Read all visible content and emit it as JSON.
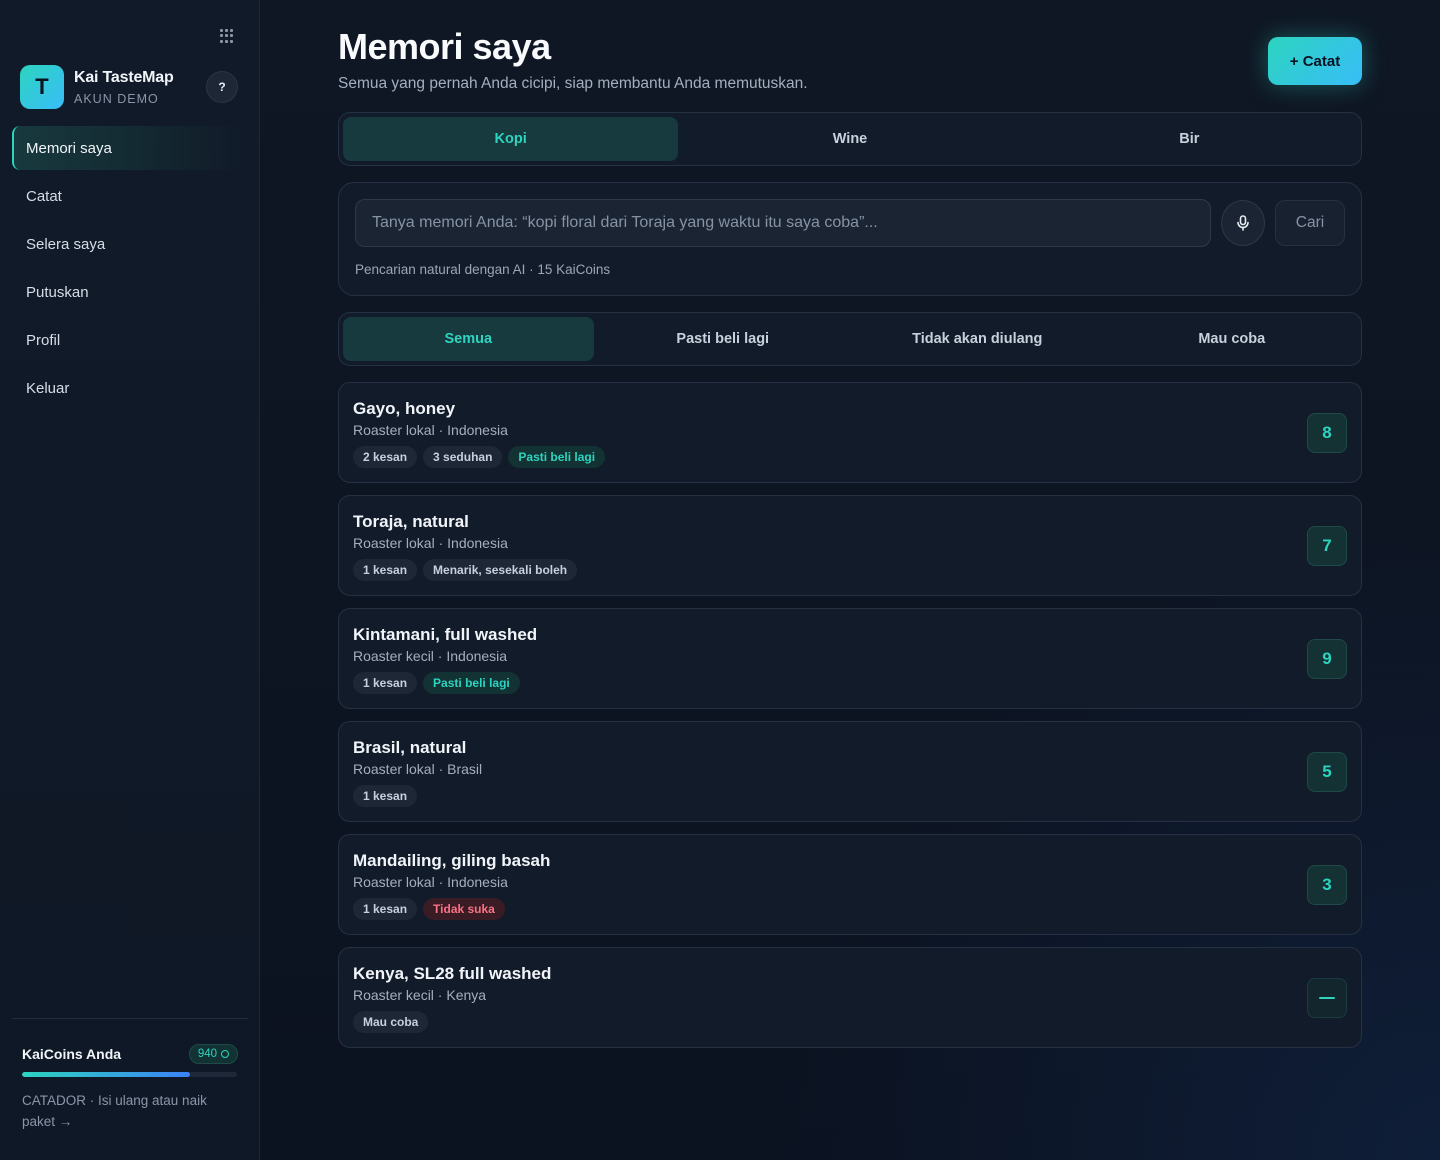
{
  "sidebar": {
    "brand_initial": "T",
    "brand_name": "Kai TasteMap",
    "brand_sub": "AKUN DEMO",
    "help_label": "?",
    "nav": [
      {
        "label": "Memori saya",
        "active": true
      },
      {
        "label": "Catat",
        "active": false
      },
      {
        "label": "Selera saya",
        "active": false
      },
      {
        "label": "Putuskan",
        "active": false
      },
      {
        "label": "Profil",
        "active": false
      },
      {
        "label": "Keluar",
        "active": false
      }
    ],
    "coins": {
      "title": "KaiCoins Anda",
      "amount": "940",
      "level_fraction": 0.78,
      "note": "CATADOR · Isi ulang atau naik paket →"
    }
  },
  "header": {
    "title": "Memori saya",
    "subtitle": "Semua yang pernah Anda cicipi, siap membantu Anda memutuskan.",
    "add_label": "+ Catat"
  },
  "category_tabs": [
    {
      "label": "Kopi",
      "active": true
    },
    {
      "label": "Wine",
      "active": false
    },
    {
      "label": "Bir",
      "active": false
    }
  ],
  "search": {
    "placeholder": "Tanya memori Anda: “kopi floral dari Toraja yang waktu itu saya coba”...",
    "button_label": "Cari",
    "hint": "Pencarian natural dengan AI · 15 KaiCoins"
  },
  "filter_tabs": [
    {
      "label": "Semua",
      "active": true
    },
    {
      "label": "Pasti beli lagi",
      "active": false
    },
    {
      "label": "Tidak akan diulang",
      "active": false
    },
    {
      "label": "Mau coba",
      "active": false
    }
  ],
  "items": [
    {
      "title": "Gayo, honey",
      "meta": "Roaster lokal · Indonesia",
      "tags": [
        {
          "label": "2 kesan",
          "kind": "neutral"
        },
        {
          "label": "3 seduhan",
          "kind": "neutral"
        },
        {
          "label": "Pasti beli lagi",
          "kind": "pos"
        }
      ],
      "score": "8"
    },
    {
      "title": "Toraja, natural",
      "meta": "Roaster lokal · Indonesia",
      "tags": [
        {
          "label": "1 kesan",
          "kind": "neutral"
        },
        {
          "label": "Menarik, sesekali boleh",
          "kind": "neutral"
        }
      ],
      "score": "7"
    },
    {
      "title": "Kintamani, full washed",
      "meta": "Roaster kecil · Indonesia",
      "tags": [
        {
          "label": "1 kesan",
          "kind": "neutral"
        },
        {
          "label": "Pasti beli lagi",
          "kind": "pos"
        }
      ],
      "score": "9"
    },
    {
      "title": "Brasil, natural",
      "meta": "Roaster lokal · Brasil",
      "tags": [
        {
          "label": "1 kesan",
          "kind": "neutral"
        }
      ],
      "score": "5"
    },
    {
      "title": "Mandailing, giling basah",
      "meta": "Roaster lokal · Indonesia",
      "tags": [
        {
          "label": "1 kesan",
          "kind": "neutral"
        },
        {
          "label": "Tidak suka",
          "kind": "neg"
        }
      ],
      "score": "3"
    },
    {
      "title": "Kenya, SL28 full washed",
      "meta": "Roaster kecil · Kenya",
      "tags": [
        {
          "label": "Mau coba",
          "kind": "neutral"
        }
      ],
      "score": null
    }
  ],
  "colors": {
    "accent": "#2dd4bf",
    "accent_secondary": "#38bdf8",
    "negative": "#fb7185",
    "background": "#0b1220"
  }
}
